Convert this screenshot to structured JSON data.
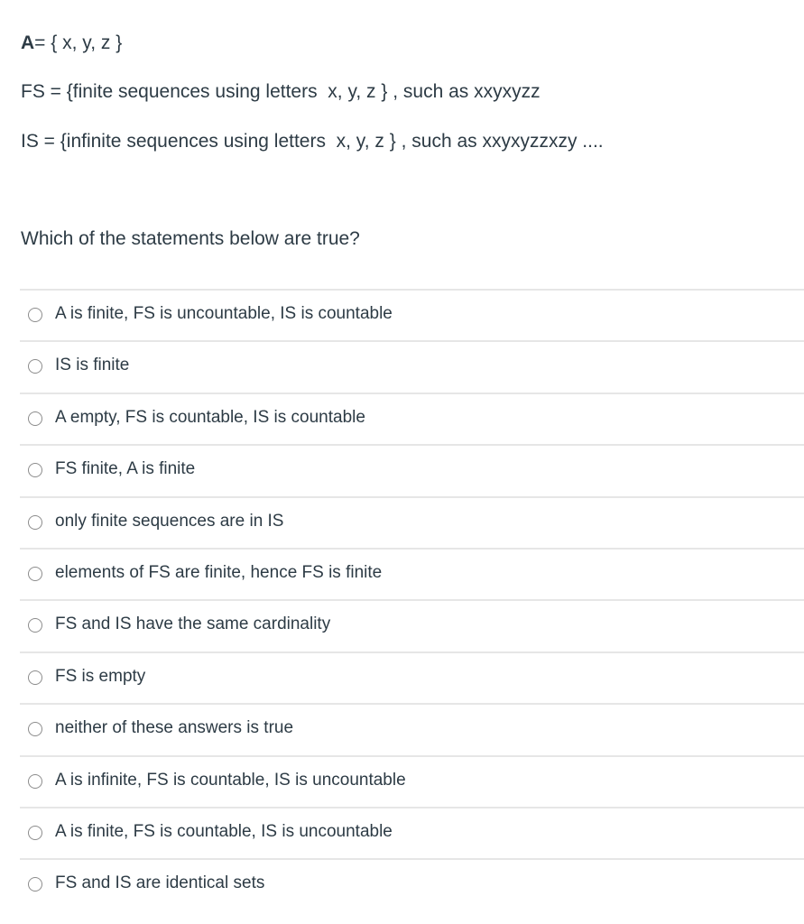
{
  "definitions": {
    "a_symbol": "A",
    "a_rest": "= { x, y, z }",
    "fs": "FS = {finite sequences using letters  x, y, z } , such as xxyxyzz",
    "is": "IS = {infinite sequences using letters  x, y, z } , such as xxyxyzzxzy ...."
  },
  "question": "Which of the statements below are true?",
  "answers": [
    {
      "label": "A is finite, FS is uncountable, IS is countable",
      "selected": false
    },
    {
      "label": "IS is finite",
      "selected": false
    },
    {
      "label": "A empty, FS is countable, IS is countable",
      "selected": false
    },
    {
      "label": "FS finite, A is finite",
      "selected": false
    },
    {
      "label": "only finite sequences are in IS",
      "selected": false
    },
    {
      "label": "elements of FS are finite, hence FS is finite",
      "selected": false
    },
    {
      "label": "FS and IS have the same cardinality",
      "selected": false
    },
    {
      "label": "FS is empty",
      "selected": false
    },
    {
      "label": "neither of these answers is true",
      "selected": false
    },
    {
      "label": "A is infinite, FS is countable, IS is uncountable",
      "selected": false
    },
    {
      "label": "A is finite, FS is countable, IS is uncountable",
      "selected": false
    },
    {
      "label": "FS and IS are identical sets",
      "selected": false
    }
  ]
}
